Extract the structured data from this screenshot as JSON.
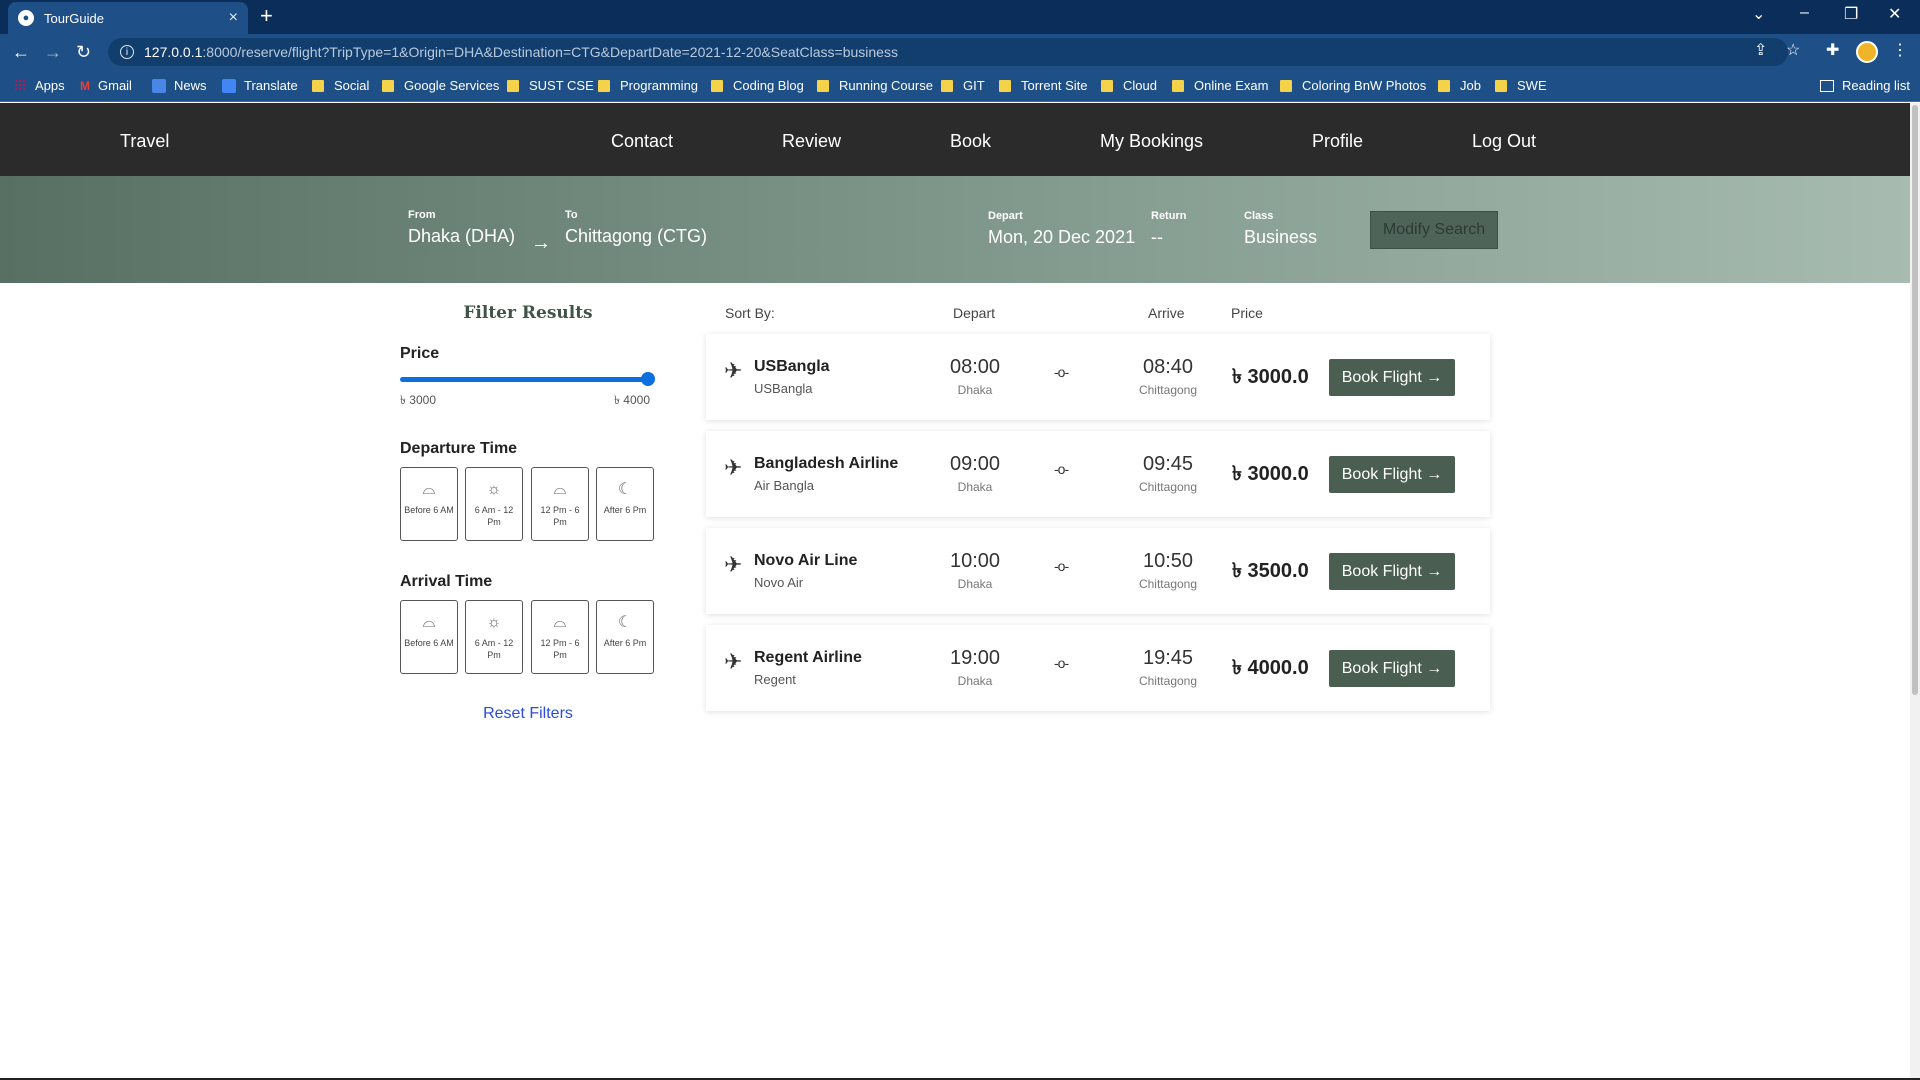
{
  "browser": {
    "tab_title": "TourGuide",
    "url_host": "127.0.0.1",
    "url_path": ":8000/reserve/flight?TripType=1&Origin=DHA&Destination=CTG&DepartDate=2021-12-20&SeatClass=business",
    "bookmarks": [
      "Apps",
      "Gmail",
      "News",
      "Translate",
      "Social",
      "Google Services",
      "SUST CSE",
      "Programming",
      "Coding Blog",
      "Running Course",
      "GIT",
      "Torrent Site",
      "Cloud",
      "Online Exam",
      "Coloring BnW Photos",
      "Job",
      "SWE"
    ],
    "reading_list": "Reading list"
  },
  "nav": {
    "brand": "Travel",
    "links": [
      "Contact",
      "Review",
      "Book",
      "My Bookings",
      "Profile",
      "Log Out"
    ]
  },
  "search": {
    "from_label": "From",
    "from_value": "Dhaka (DHA)",
    "arrow": "→",
    "to_label": "To",
    "to_value": "Chittagong (CTG)",
    "depart_label": "Depart",
    "depart_value": "Mon, 20 Dec 2021",
    "return_label": "Return",
    "return_value": "--",
    "class_label": "Class",
    "class_value": "Business",
    "modify_button": "Modify Search"
  },
  "filters": {
    "title": "Filter Results",
    "price_label": "Price",
    "price_min": "৳ 3000",
    "price_max": "৳ 4000",
    "slider_fraction": 1.0,
    "departure_label": "Departure Time",
    "arrival_label": "Arrival Time",
    "time_slots": [
      "Before 6 AM",
      "6 Am - 12 Pm",
      "12 Pm - 6 Pm",
      "After 6 Pm"
    ],
    "reset": "Reset Filters"
  },
  "results": {
    "sort_by": "Sort By:",
    "col_depart": "Depart",
    "col_arrive": "Arrive",
    "col_price": "Price",
    "book_label": "Book Flight →",
    "flights": [
      {
        "airline": "USBangla",
        "sub": "USBangla",
        "depart": "08:00",
        "from": "Dhaka",
        "arrive": "08:40",
        "to": "Chittagong",
        "price": "৳ 3000.0"
      },
      {
        "airline": "Bangladesh Airline",
        "sub": "Air Bangla",
        "depart": "09:00",
        "from": "Dhaka",
        "arrive": "09:45",
        "to": "Chittagong",
        "price": "৳ 3000.0"
      },
      {
        "airline": "Novo Air Line",
        "sub": "Novo Air",
        "depart": "10:00",
        "from": "Dhaka",
        "arrive": "10:50",
        "to": "Chittagong",
        "price": "৳ 3500.0"
      },
      {
        "airline": "Regent Airline",
        "sub": "Regent",
        "depart": "19:00",
        "from": "Dhaka",
        "arrive": "19:45",
        "to": "Chittagong",
        "price": "৳ 4000.0"
      }
    ]
  }
}
